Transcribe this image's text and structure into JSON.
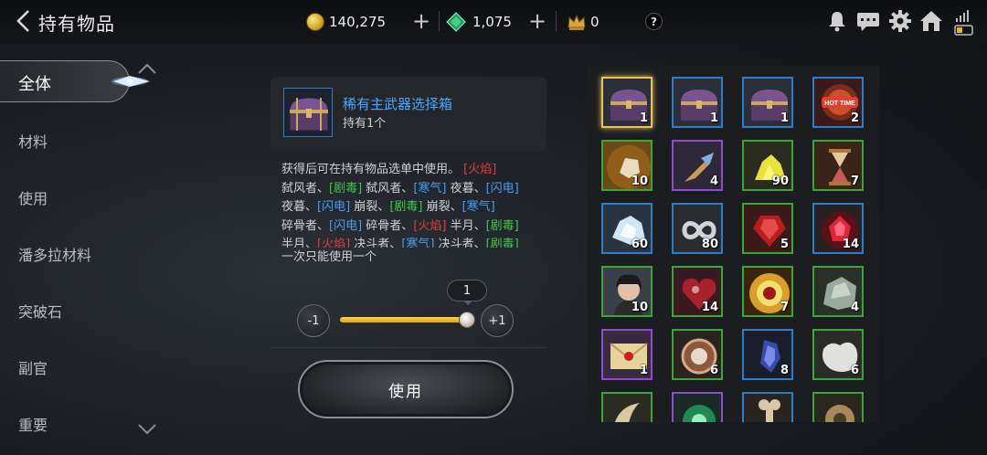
{
  "header": {
    "title": "持有物品",
    "gold": "140,275",
    "gems": "1,075",
    "crowns": "0",
    "help": "?"
  },
  "menu": {
    "items": [
      "全体",
      "材料",
      "使用",
      "潘多拉材料",
      "突破石",
      "副官",
      "重要"
    ],
    "active_index": 0
  },
  "detail": {
    "name": "稀有主武器选择箱",
    "owned": "持有1个",
    "desc_lines": [
      [
        [
          "获得后可在持有物品选单中使用。 ",
          ""
        ],
        [
          "[火焰]",
          "r"
        ]
      ],
      [
        [
          "弑风者、",
          ""
        ],
        [
          "[剧毒]",
          "g"
        ],
        [
          " 弑风者、",
          ""
        ],
        [
          "[寒气]",
          "b"
        ],
        [
          " 夜暮、",
          ""
        ],
        [
          "[闪电]",
          "b"
        ]
      ],
      [
        [
          "夜暮、",
          ""
        ],
        [
          "[闪电]",
          "b"
        ],
        [
          " 崩裂、",
          ""
        ],
        [
          "[剧毒]",
          "g"
        ],
        [
          " 崩裂、",
          ""
        ],
        [
          "[寒气]",
          "b"
        ]
      ],
      [
        [
          "碎骨者、",
          ""
        ],
        [
          "[闪电]",
          "b"
        ],
        [
          " 碎骨者、",
          ""
        ],
        [
          "[火焰]",
          "r"
        ],
        [
          " 半月、",
          ""
        ],
        [
          "[剧毒]",
          "g"
        ]
      ],
      [
        [
          "半月、",
          ""
        ],
        [
          "[火焰]",
          "r"
        ],
        [
          " 决斗者、",
          ""
        ],
        [
          "[寒气]",
          "b"
        ],
        [
          " 决斗者、",
          ""
        ],
        [
          "[剧毒]",
          "g"
        ]
      ]
    ],
    "once": "一次只能使用一个",
    "quantity": "1",
    "minus": "-1",
    "plus": "+1",
    "slider_fraction": 1.0,
    "use_label": "使用"
  },
  "inventory": [
    {
      "icon": "chest-icon",
      "count": "1",
      "border": "sel"
    },
    {
      "icon": "chest-icon",
      "count": "1",
      "border": "blue"
    },
    {
      "icon": "chest-icon",
      "count": "1",
      "border": "blue"
    },
    {
      "icon": "hot-time-icon",
      "count": "2",
      "border": "blue",
      "label": "HOT TIME"
    },
    {
      "icon": "ore-icon",
      "count": "10",
      "border": "green"
    },
    {
      "icon": "drill-icon",
      "count": "4",
      "border": "purple"
    },
    {
      "icon": "yellow-crystal-icon",
      "count": "90",
      "border": "green"
    },
    {
      "icon": "hourglass-icon",
      "count": "7",
      "border": "green"
    },
    {
      "icon": "ice-crystal-icon",
      "count": "60",
      "border": "blue"
    },
    {
      "icon": "infinity-icon",
      "count": "80",
      "border": "blue"
    },
    {
      "icon": "red-gem-icon",
      "count": "5",
      "border": "green"
    },
    {
      "icon": "ruby-icon",
      "count": "14",
      "border": "blue"
    },
    {
      "icon": "portrait-icon",
      "count": "10",
      "border": "green"
    },
    {
      "icon": "heart-icon",
      "count": "14",
      "border": "green"
    },
    {
      "icon": "eye-orb-icon",
      "count": "7",
      "border": "green"
    },
    {
      "icon": "rock-icon",
      "count": "4",
      "border": "green"
    },
    {
      "icon": "letter-icon",
      "count": "1",
      "border": "purple"
    },
    {
      "icon": "medal-icon",
      "count": "6",
      "border": "green"
    },
    {
      "icon": "blue-shard-icon",
      "count": "8",
      "border": "blue"
    },
    {
      "icon": "white-cloth-icon",
      "count": "6",
      "border": "green"
    },
    {
      "icon": "horn-icon",
      "count": "",
      "border": "green"
    },
    {
      "icon": "green-orb-icon",
      "count": "",
      "border": "purple"
    },
    {
      "icon": "bone-icon",
      "count": "",
      "border": "blue"
    },
    {
      "icon": "gear-item-icon",
      "count": "",
      "border": "green"
    }
  ]
}
